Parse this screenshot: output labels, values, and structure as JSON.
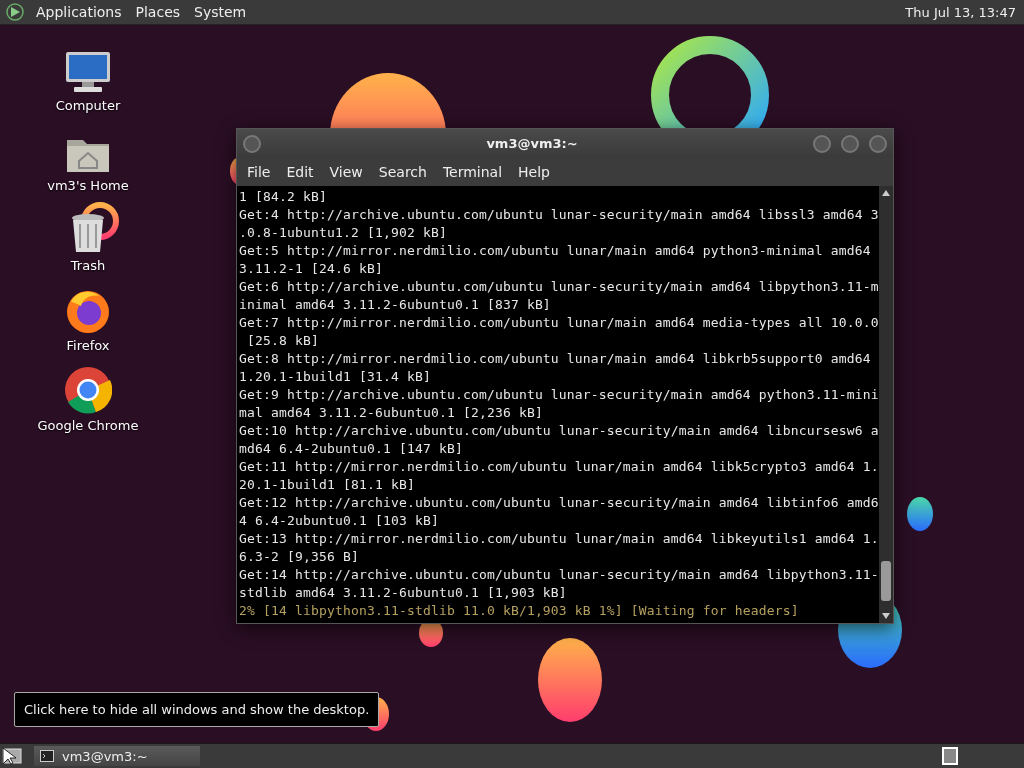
{
  "top_panel": {
    "menus": [
      "Applications",
      "Places",
      "System"
    ],
    "clock": "Thu Jul 13, 13:47"
  },
  "desktop_icons": [
    {
      "kind": "computer",
      "label": "Computer"
    },
    {
      "kind": "home",
      "label": "vm3's Home"
    },
    {
      "kind": "trash",
      "label": "Trash"
    },
    {
      "kind": "firefox",
      "label": "Firefox"
    },
    {
      "kind": "chrome",
      "label": "Google Chrome"
    }
  ],
  "terminal": {
    "title": "vm3@vm3:~",
    "menus": [
      "File",
      "Edit",
      "View",
      "Search",
      "Terminal",
      "Help"
    ],
    "rows": [
      {
        "kind": "output",
        "text": "1 [84.2 kB]"
      },
      {
        "kind": "output",
        "text": "Get:4 http://archive.ubuntu.com/ubuntu lunar-security/main amd64 libssl3 amd64 3"
      },
      {
        "kind": "output",
        "text": ".0.8-1ubuntu1.2 [1,902 kB]"
      },
      {
        "kind": "output",
        "text": "Get:5 http://mirror.nerdmilio.com/ubuntu lunar/main amd64 python3-minimal amd64"
      },
      {
        "kind": "output",
        "text": "3.11.2-1 [24.6 kB]"
      },
      {
        "kind": "output",
        "text": "Get:6 http://archive.ubuntu.com/ubuntu lunar-security/main amd64 libpython3.11-m"
      },
      {
        "kind": "output",
        "text": "inimal amd64 3.11.2-6ubuntu0.1 [837 kB]"
      },
      {
        "kind": "output",
        "text": "Get:7 http://mirror.nerdmilio.com/ubuntu lunar/main amd64 media-types all 10.0.0"
      },
      {
        "kind": "output",
        "text": " [25.8 kB]"
      },
      {
        "kind": "output",
        "text": "Get:8 http://mirror.nerdmilio.com/ubuntu lunar/main amd64 libkrb5support0 amd64"
      },
      {
        "kind": "output",
        "text": "1.20.1-1build1 [31.4 kB]"
      },
      {
        "kind": "output",
        "text": "Get:9 http://archive.ubuntu.com/ubuntu lunar-security/main amd64 python3.11-mini"
      },
      {
        "kind": "output",
        "text": "mal amd64 3.11.2-6ubuntu0.1 [2,236 kB]"
      },
      {
        "kind": "output",
        "text": "Get:10 http://archive.ubuntu.com/ubuntu lunar-security/main amd64 libncursesw6 a"
      },
      {
        "kind": "output",
        "text": "md64 6.4-2ubuntu0.1 [147 kB]"
      },
      {
        "kind": "output",
        "text": "Get:11 http://mirror.nerdmilio.com/ubuntu lunar/main amd64 libk5crypto3 amd64 1."
      },
      {
        "kind": "output",
        "text": "20.1-1build1 [81.1 kB]"
      },
      {
        "kind": "output",
        "text": "Get:12 http://archive.ubuntu.com/ubuntu lunar-security/main amd64 libtinfo6 amd6"
      },
      {
        "kind": "output",
        "text": "4 6.4-2ubuntu0.1 [103 kB]"
      },
      {
        "kind": "output",
        "text": "Get:13 http://mirror.nerdmilio.com/ubuntu lunar/main amd64 libkeyutils1 amd64 1."
      },
      {
        "kind": "output",
        "text": "6.3-2 [9,356 B]"
      },
      {
        "kind": "output",
        "text": "Get:14 http://archive.ubuntu.com/ubuntu lunar-security/main amd64 libpython3.11-"
      },
      {
        "kind": "output",
        "text": "stdlib amd64 3.11.2-6ubuntu0.1 [1,903 kB]"
      },
      {
        "kind": "progress",
        "text": "2% [14 libpython3.11-stdlib 11.0 kB/1,903 kB 1%] [Waiting for headers]"
      }
    ]
  },
  "tooltip": "Click here to hide all windows and show the desktop.",
  "bottom_panel": {
    "tasks": [
      {
        "label": "vm3@vm3:~",
        "selected": false
      }
    ]
  }
}
